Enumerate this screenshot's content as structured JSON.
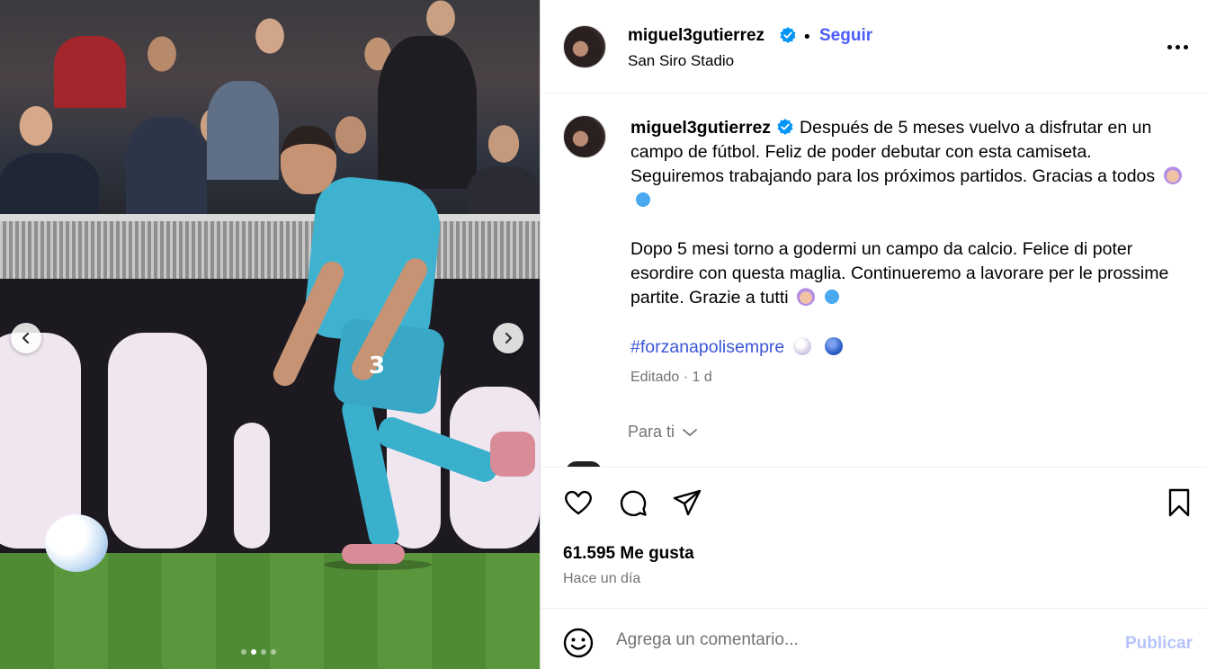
{
  "media": {
    "jersey_number": "3",
    "carousel": {
      "total": 4,
      "active_index": 1
    },
    "prev_icon": "chevron-left-icon",
    "next_icon": "chevron-right-icon"
  },
  "header": {
    "username": "miguel3gutierrez",
    "verified": true,
    "separator": "•",
    "follow_label": "Seguir",
    "location": "San Siro Stadio",
    "more_icon": "more-options-icon"
  },
  "caption": {
    "username": "miguel3gutierrez",
    "text_es": "Después de 5 meses vuelvo a disfrutar en un campo de fútbol. Feliz de poder debutar con esta camiseta. Seguiremos trabajando para los próximos partidos. Gracias a todos",
    "text_it": "Dopo 5 mesi torno a godermi un campo da calcio. Felice di poter esordire con questa maglia. Continueremo a lavorare per le prossime partite. Grazie a tutti",
    "hashtag": "#forzanapolisempre",
    "meta": "Editado · 1 d"
  },
  "for_you": {
    "label": "Para ti"
  },
  "actions": {
    "like_icon": "heart-icon",
    "comment_icon": "comment-icon",
    "share_icon": "share-icon",
    "save_icon": "bookmark-icon"
  },
  "stats": {
    "likes": "61.595 Me gusta",
    "time_ago": "Hace un día"
  },
  "comment": {
    "placeholder": "Agrega un comentario...",
    "publish_label": "Publicar"
  },
  "colors": {
    "accent": "#4a5df9",
    "hashtag": "#3b56d6",
    "muted": "#737373",
    "publish_disabled": "#b7c4fb",
    "verified": "#0095f6"
  }
}
